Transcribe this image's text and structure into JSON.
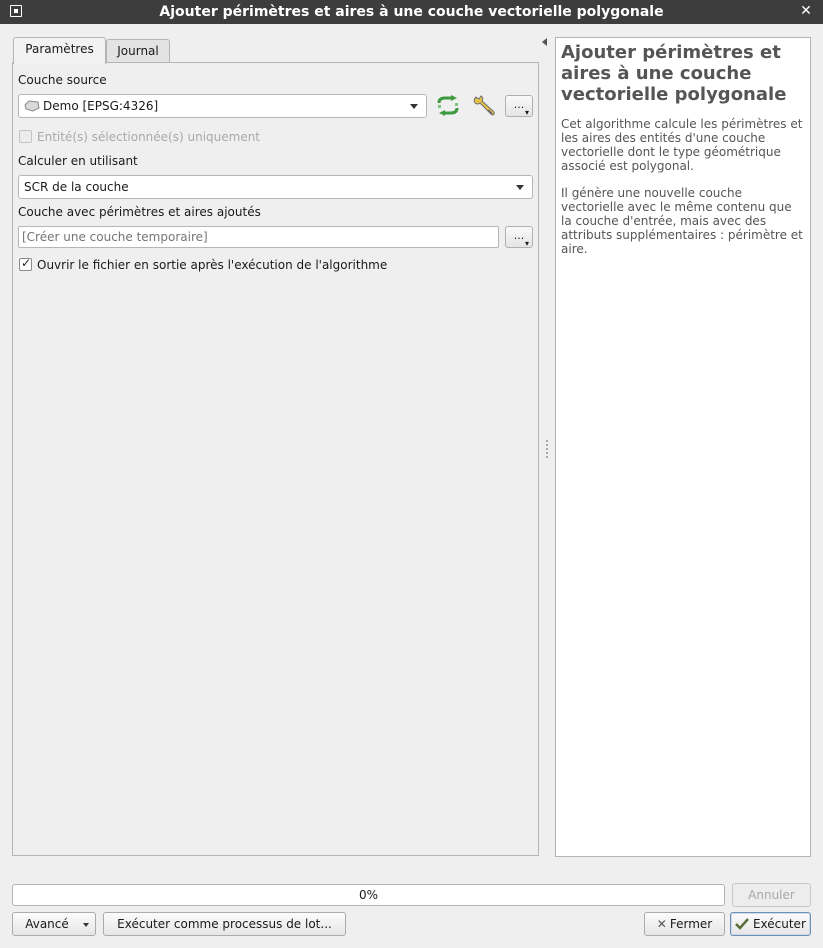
{
  "window": {
    "title": "Ajouter périmètres et aires à une couche vectorielle polygonale"
  },
  "tabs": [
    {
      "label": "Paramètres",
      "active": true
    },
    {
      "label": "Journal",
      "active": false
    }
  ],
  "params": {
    "source_label": "Couche source",
    "source_value": "Demo [EPSG:4326]",
    "selected_only_label": "Entité(s) sélectionnée(s) uniquement",
    "selected_only_checked": false,
    "calc_label": "Calculer en utilisant",
    "calc_value": "SCR de la couche",
    "output_label": "Couche avec périmètres et aires ajoutés",
    "output_placeholder": "[Créer une couche temporaire]",
    "open_output_label": "Ouvrir le fichier en sortie après l'exécution de l'algorithme",
    "open_output_checked": true,
    "dots_label": "..."
  },
  "help": {
    "title": "Ajouter périmètres et aires à une couche vectorielle polygonale",
    "paragraphs": [
      "Cet algorithme calcule les périmètres et les aires des entités d'une couche vectorielle dont le type géométrique associé est polygonal.",
      "Il génère une nouvelle couche vectorielle avec le même contenu que la couche d'entrée, mais avec des attributs supplémentaires : périmètre et aire."
    ]
  },
  "progress": {
    "text": "0%",
    "value": 0
  },
  "buttons": {
    "annuler": "Annuler",
    "avance": "Avancé",
    "batch": "Exécuter comme processus de lot...",
    "fermer": "Fermer",
    "executer": "Exécuter"
  },
  "colors": {
    "titlebar": "#3d3d3d",
    "accent": "#6f8fb3",
    "refresh_icon": "#3e9a3e"
  }
}
